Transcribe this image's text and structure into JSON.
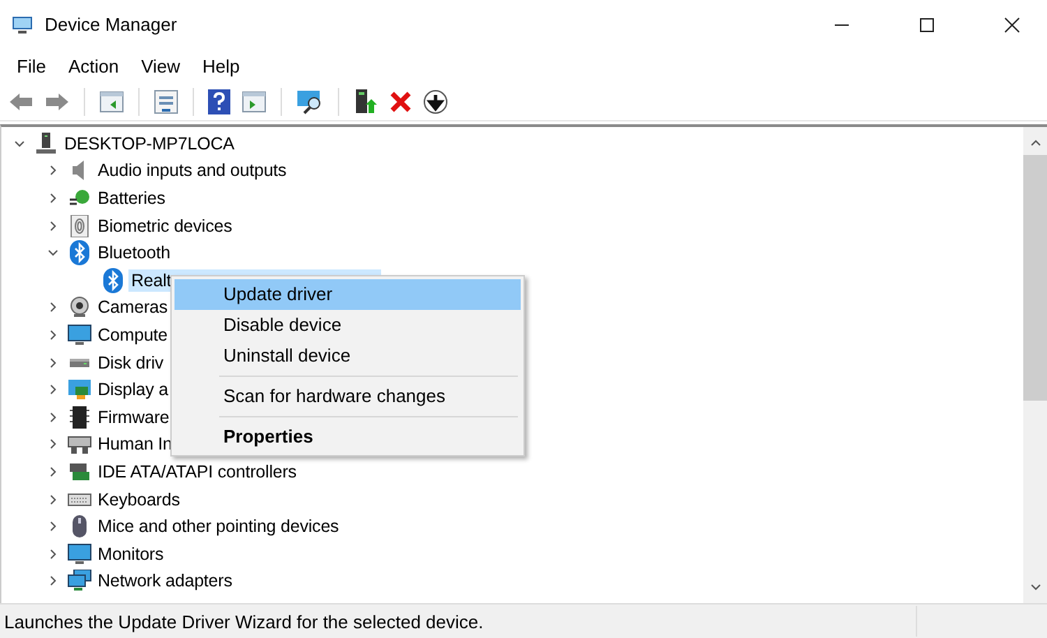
{
  "window": {
    "title": "Device Manager"
  },
  "menu_bar": [
    "File",
    "Action",
    "View",
    "Help"
  ],
  "tree": {
    "label": "DESKTOP-MP7LOCA",
    "expanded": true,
    "selected": false,
    "children": [
      {
        "label": "Audio inputs and outputs",
        "expanded": false,
        "selected": false
      },
      {
        "label": "Batteries",
        "expanded": false,
        "selected": false
      },
      {
        "label": "Biometric devices",
        "expanded": false,
        "selected": false
      },
      {
        "label": "Bluetooth",
        "expanded": true,
        "selected": false,
        "children": [
          {
            "label": "Realt",
            "selected": true
          }
        ]
      },
      {
        "label": "Cameras",
        "expanded": false,
        "selected": false
      },
      {
        "label": "Compute",
        "expanded": false,
        "selected": false
      },
      {
        "label": "Disk driv",
        "expanded": false,
        "selected": false
      },
      {
        "label": "Display a",
        "expanded": false,
        "selected": false
      },
      {
        "label": "Firmware",
        "expanded": false,
        "selected": false
      },
      {
        "label": "Human In",
        "expanded": false,
        "selected": false
      },
      {
        "label": "IDE ATA/ATAPI controllers",
        "expanded": false,
        "selected": false
      },
      {
        "label": "Keyboards",
        "expanded": false,
        "selected": false
      },
      {
        "label": "Mice and other pointing devices",
        "expanded": false,
        "selected": false
      },
      {
        "label": "Monitors",
        "expanded": false,
        "selected": false
      },
      {
        "label": "Network adapters",
        "expanded": false,
        "selected": false
      }
    ]
  },
  "context_menu": [
    {
      "kind": "item",
      "label": "Update driver",
      "selected": true,
      "default": false
    },
    {
      "kind": "item",
      "label": "Disable device",
      "selected": false,
      "default": false
    },
    {
      "kind": "item",
      "label": "Uninstall device",
      "selected": false,
      "default": false
    },
    {
      "kind": "separator"
    },
    {
      "kind": "item",
      "label": "Scan for hardware changes",
      "selected": false,
      "default": false
    },
    {
      "kind": "separator"
    },
    {
      "kind": "item",
      "label": "Properties",
      "selected": false,
      "default": true
    }
  ],
  "status_bar": "Launches the Update Driver Wizard for the selected device."
}
